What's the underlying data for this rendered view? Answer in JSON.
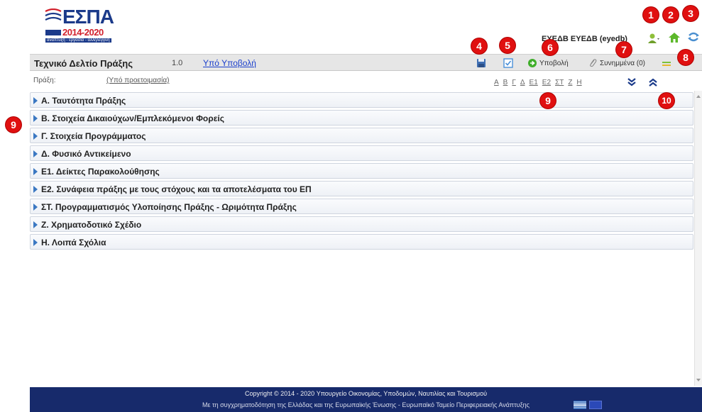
{
  "brand": {
    "logo_text": "ΕΣΠΑ",
    "years": "2014-2020",
    "tagline": "ανάπτυξη - εργασία - αλληλεγγύη"
  },
  "user": {
    "name": "ΕΥΕΔΒ ΕΥΕΔΒ (eyedb)"
  },
  "badges": [
    "1",
    "2",
    "3",
    "4",
    "5",
    "6",
    "7",
    "8",
    "9",
    "10"
  ],
  "title_bar": {
    "title": "Τεχνικό Δελτίο Πράξης",
    "version": "1.0",
    "status": "Υπό Υποβολή",
    "submit_label": "Υποβολή",
    "attachments_label": "Συνημμένα (0)"
  },
  "sub_bar": {
    "label": "Πράξη:",
    "value": "(Υπό προετοιμασία)",
    "letters": [
      "Α",
      "Β",
      "Γ",
      "Δ",
      "Ε1",
      "Ε2",
      "ΣΤ",
      "Ζ",
      "Η"
    ]
  },
  "sections": [
    {
      "label": "Α. Ταυτότητα Πράξης"
    },
    {
      "label": "Β. Στοιχεία Δικαιούχων/Εμπλεκόμενοι Φορείς"
    },
    {
      "label": "Γ. Στοιχεία Προγράμματος"
    },
    {
      "label": "Δ. Φυσικό Αντικείμενο"
    },
    {
      "label": "Ε1. Δείκτες Παρακολούθησης"
    },
    {
      "label": "Ε2. Συνάφεια πράξης με τους στόχους και τα αποτελέσματα του ΕΠ"
    },
    {
      "label": "ΣΤ. Προγραμματισμός Υλοποίησης Πράξης - Ωριμότητα Πράξης"
    },
    {
      "label": "Ζ. Χρηματοδοτικό Σχέδιο"
    },
    {
      "label": "Η. Λοιπά Σχόλια"
    }
  ],
  "footer": {
    "copyright": "Copyright © 2014 - 2020 Υπουργείο Οικονομίας, Υποδομών, Ναυτιλίας και Τουρισμού",
    "cofunding": "Με τη συγχρηματοδότηση της Ελλάδας και της Ευρωπαϊκής Ένωσης - Ευρωπαϊκό Ταμείο Περιφερειακής Ανάπτυξης"
  },
  "colors": {
    "badge": "#e01010",
    "link": "#1a3fcc",
    "footer_bg": "#172a6b",
    "section_arrow": "#3b78c2",
    "brand_blue": "#1b3a8a",
    "brand_red": "#d21f2b"
  },
  "icons": {
    "user_menu": "user-icon",
    "home": "home-icon",
    "logout": "logout-icon",
    "save": "save-icon",
    "validate": "check-icon",
    "submit": "submit-icon",
    "attachments": "paperclip-icon",
    "menu": "menu-icon",
    "collapse_all": "double-chevron-down-icon",
    "expand_all": "double-chevron-up-icon"
  }
}
